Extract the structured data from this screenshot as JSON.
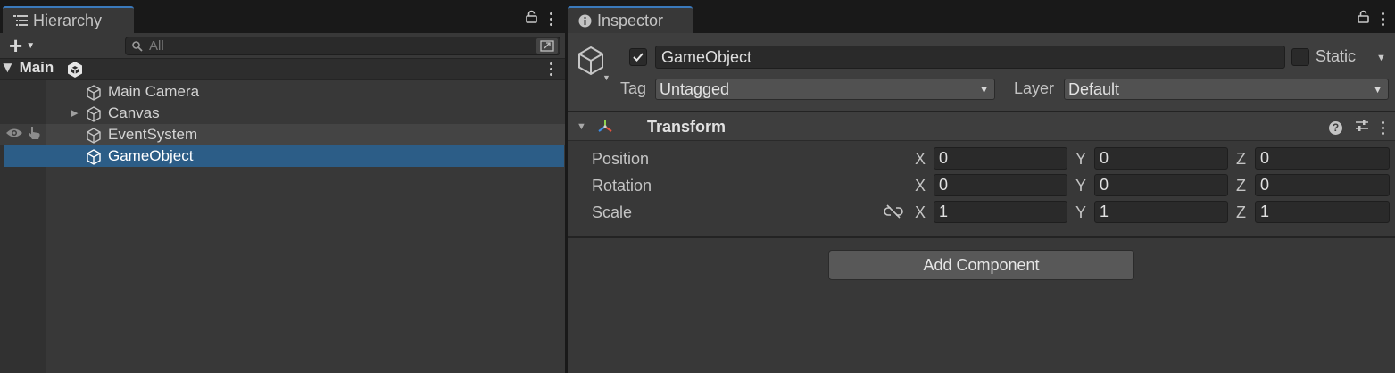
{
  "hierarchy": {
    "tab_label": "Hierarchy",
    "search_placeholder": "All",
    "add_icon": "plus-icon",
    "scene": {
      "name": "Main"
    },
    "items": [
      {
        "name": "Main Camera",
        "expandable": false,
        "state": "normal"
      },
      {
        "name": "Canvas",
        "expandable": true,
        "state": "normal"
      },
      {
        "name": "EventSystem",
        "expandable": false,
        "state": "hover"
      },
      {
        "name": "GameObject",
        "expandable": false,
        "state": "selected"
      }
    ]
  },
  "inspector": {
    "tab_label": "Inspector",
    "object": {
      "name": "GameObject",
      "active": true,
      "static_label": "Static",
      "static": false,
      "tag_label": "Tag",
      "tag_value": "Untagged",
      "layer_label": "Layer",
      "layer_value": "Default"
    },
    "transform": {
      "title": "Transform",
      "rows": [
        {
          "label": "Position",
          "x": "0",
          "y": "0",
          "z": "0"
        },
        {
          "label": "Rotation",
          "x": "0",
          "y": "0",
          "z": "0"
        },
        {
          "label": "Scale",
          "x": "1",
          "y": "1",
          "z": "1"
        }
      ],
      "axis_x": "X",
      "axis_y": "Y",
      "axis_z": "Z"
    },
    "add_component_label": "Add Component"
  },
  "colors": {
    "selection": "#2c5d87",
    "tab_accent": "#3a79bb",
    "panel_bg": "#383838"
  }
}
